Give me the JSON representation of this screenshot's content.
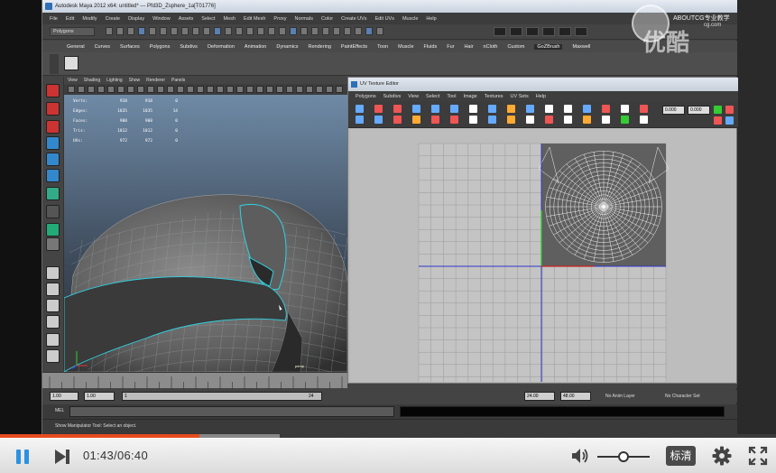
{
  "player": {
    "current_time": "01:43",
    "duration": "06:40",
    "time_display": "01:43/06:40",
    "progress_fraction": 0.257,
    "buffered_fraction": 0.36,
    "volume_fraction": 0.5,
    "quality_label": "标清",
    "accent_color": "#e84c1e",
    "play_color": "#2c92e0",
    "icons": [
      "pause-icon",
      "next-icon",
      "volume-icon",
      "settings-gear-icon",
      "fullscreen-icon"
    ]
  },
  "watermark": {
    "brand": "ABOUTCG专业教学",
    "site": "cg.com",
    "logo": "优酷"
  },
  "maya": {
    "title": "Autodesk Maya 2012 x64: untitled*  ---  Pfd3D_Zsphere_1a[T01776]",
    "menus": [
      "File",
      "Edit",
      "Modify",
      "Create",
      "Display",
      "Window",
      "Assets",
      "Select",
      "Mesh",
      "Edit Mesh",
      "Proxy",
      "Normals",
      "Color",
      "Create UVs",
      "Edit UVs",
      "Muscle",
      "Help"
    ],
    "mode": "Polygons",
    "shelf_tabs": [
      "General",
      "Curves",
      "Surfaces",
      "Polygons",
      "Subdivs",
      "Deformation",
      "Animation",
      "Dynamics",
      "Rendering",
      "PaintEffects",
      "Toon",
      "Muscle",
      "Fluids",
      "Fur",
      "Hair",
      "nCloth",
      "Custom",
      "GoZBrush",
      "Maxwell"
    ],
    "active_shelf": "GoZBrush",
    "viewport": {
      "menus": [
        "View",
        "Shading",
        "Lighting",
        "Show",
        "Renderer",
        "Panels"
      ],
      "hud": [
        {
          "label": "Verts:",
          "a": "918",
          "b": "918",
          "c": "0"
        },
        {
          "label": "Edges:",
          "a": "1835",
          "b": "1835",
          "c": "14"
        },
        {
          "label": "Faces:",
          "a": "908",
          "b": "908",
          "c": "0"
        },
        {
          "label": "Tris:",
          "a": "1812",
          "b": "1812",
          "c": "0"
        },
        {
          "label": "UVs:",
          "a": "972",
          "b": "972",
          "c": "0"
        }
      ],
      "camera": "persp"
    },
    "uv_editor": {
      "title": "UV Texture Editor",
      "menus": [
        "Polygons",
        "Subdivs",
        "View",
        "Select",
        "Tool",
        "Image",
        "Textures",
        "UV Sets",
        "Help"
      ],
      "field1": "0.000",
      "field2": "0.000"
    },
    "range": {
      "start": "1.00",
      "playback_start": "1.00",
      "current": "1",
      "mid_mark": "24",
      "playback_end": "24.00",
      "end": "48.00",
      "anim_layer": "No Anim Layer",
      "character_set": "No Character Set"
    },
    "mel_label": "MEL",
    "help_line": "Show Manipulator Tool: Select an object."
  }
}
